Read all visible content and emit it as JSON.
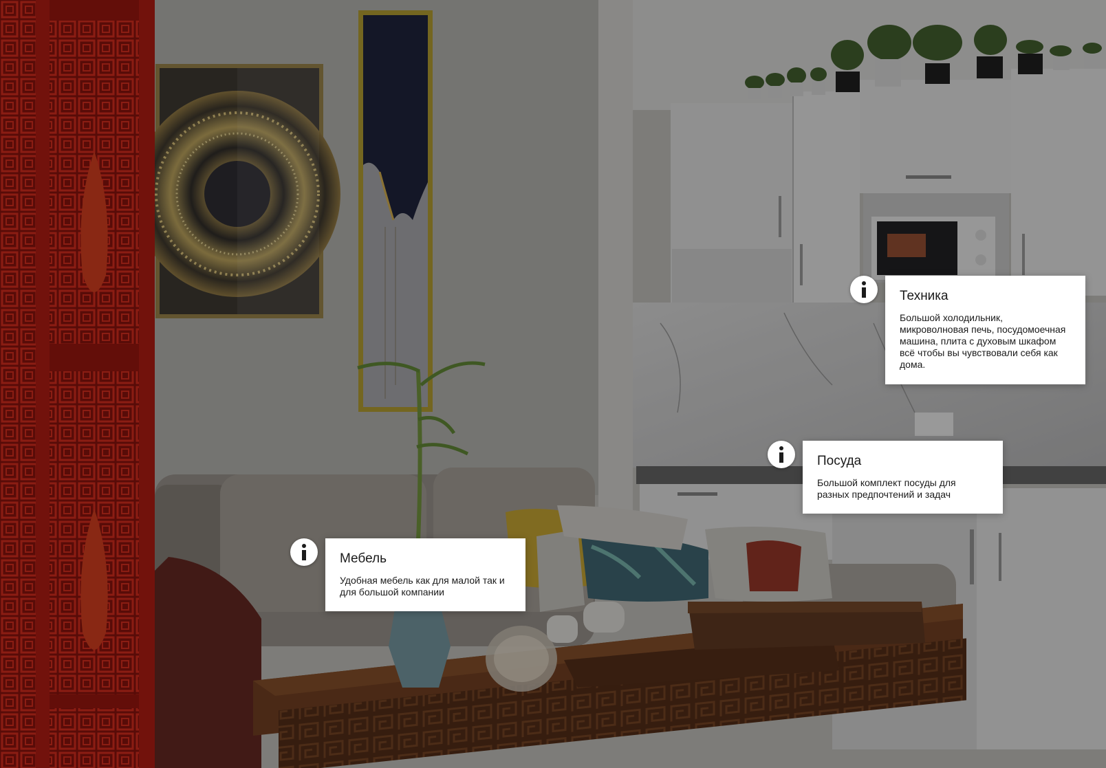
{
  "hotspots": [
    {
      "id": "tech",
      "title": "Техника",
      "text": "Большой холодильник, микроволновая печь, посудомоечная машина, плита с духовым шкафом всё чтобы вы чувствовали себя как дома."
    },
    {
      "id": "dishes",
      "title": "Посуда",
      "text": "Большой комплект посуды для разных предпочтений и задач"
    },
    {
      "id": "furniture",
      "title": "Мебель",
      "text": "Удобная мебель как для малой так и для большой компании"
    }
  ],
  "icons": {
    "info": "info-icon"
  },
  "colors": {
    "card": "#ffffff",
    "text": "#1a1a1a",
    "overlay": "rgba(0,0,0,0.32)"
  }
}
